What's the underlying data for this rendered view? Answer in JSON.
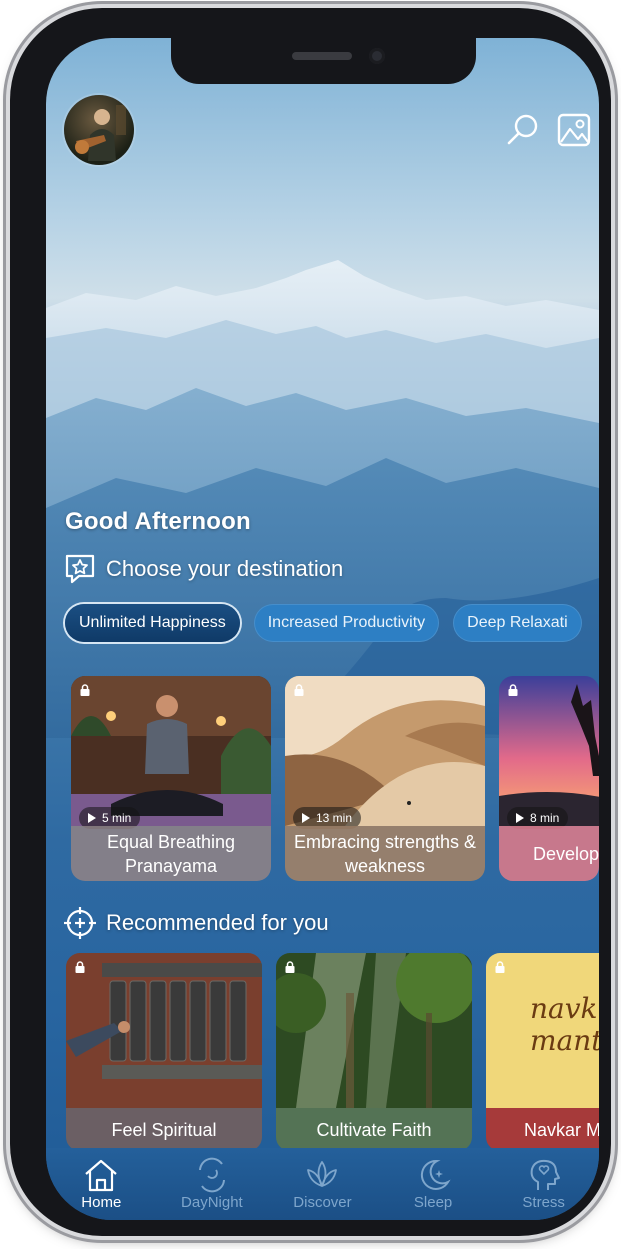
{
  "header": {
    "avatar_alt": "profile avatar",
    "actions": [
      "search-icon",
      "image-icon"
    ]
  },
  "greeting": "Good Afternoon",
  "destination": {
    "title": "Choose your destination",
    "icon": "star-badge-icon"
  },
  "chips": [
    {
      "label": "Unlimited Happiness",
      "active": true
    },
    {
      "label": "Increased Productivity",
      "active": false
    },
    {
      "label": "Deep Relaxati",
      "active": false
    }
  ],
  "destination_cards": [
    {
      "title": "Equal Breathing Pranayama",
      "duration": "5 min",
      "locked": true
    },
    {
      "title": "Embracing strengths & weakness",
      "duration": "13 min",
      "locked": true
    },
    {
      "title": "Develop Confi",
      "duration": "8 min",
      "locked": true
    }
  ],
  "recommended": {
    "title": "Recommended for you",
    "icon": "crosshair-plus-icon"
  },
  "recommended_cards": [
    {
      "title": "Feel Spiritual",
      "locked": true
    },
    {
      "title": "Cultivate Faith",
      "locked": true
    },
    {
      "title": "Navkar M",
      "art_text": "navk mant",
      "locked": true
    }
  ],
  "tabs": [
    {
      "label": "Home",
      "icon": "home-icon",
      "active": true
    },
    {
      "label": "DayNight",
      "icon": "daynight-icon",
      "active": false
    },
    {
      "label": "Discover",
      "icon": "lotus-icon",
      "active": false
    },
    {
      "label": "Sleep",
      "icon": "moon-icon",
      "active": false
    },
    {
      "label": "Stress",
      "icon": "head-heart-icon",
      "active": false
    }
  ],
  "colors": {
    "accent": "#2d7fc4",
    "active_chip": "#0f3a67",
    "tabbar": "#1f5890"
  }
}
